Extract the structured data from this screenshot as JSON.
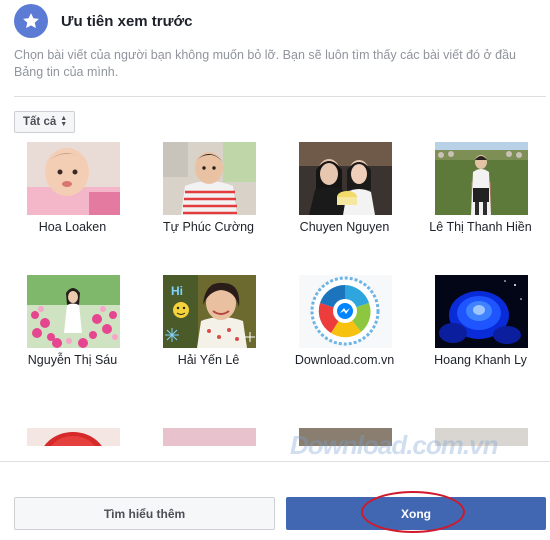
{
  "dialog": {
    "title": "Ưu tiên xem trước",
    "description": "Chọn bài viết của người bạn không muốn bỏ lỡ. Bạn sẽ luôn tìm thấy các bài viết đó ở đầu Bảng tin của mình.",
    "filter_label": "Tất cả"
  },
  "people": [
    {
      "name": "Hoa Loaken"
    },
    {
      "name": "Tự Phúc Cường"
    },
    {
      "name": "Chuyen Nguyen"
    },
    {
      "name": "Lê Thị Thanh Hiền"
    },
    {
      "name": "Nguyễn Thị Sáu"
    },
    {
      "name": "Hải Yến Lê"
    },
    {
      "name": "Download.com.vn"
    },
    {
      "name": "Hoang Khanh Ly"
    },
    {
      "name": ""
    },
    {
      "name": ""
    },
    {
      "name": ""
    },
    {
      "name": ""
    }
  ],
  "footer": {
    "learn_more_label": "Tìm hiểu thêm",
    "done_label": "Xong"
  },
  "watermark": "Download.com.vn",
  "colors": {
    "accent": "#4267b2",
    "star_icon_bg": "#5b7bd5",
    "highlight_oval": "#d0192b"
  }
}
